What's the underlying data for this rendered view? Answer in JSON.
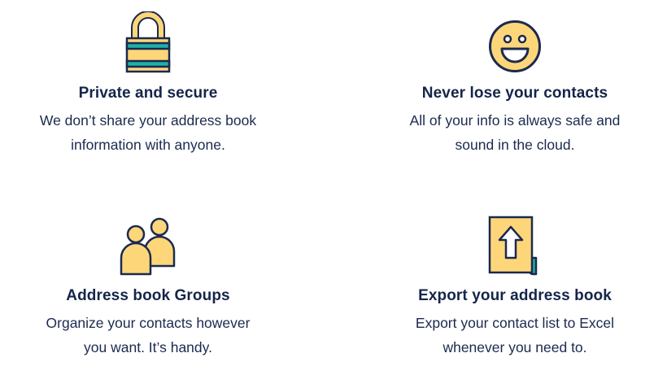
{
  "colors": {
    "navy": "#1b2a4e",
    "yellow": "#fed67a",
    "teal": "#1fb0a8"
  },
  "features": [
    {
      "icon": "padlock-icon",
      "title": "Private and secure",
      "line1": "We don’t share your address book",
      "line2": "information with anyone."
    },
    {
      "icon": "smiley-face-icon",
      "title": "Never lose your contacts",
      "line1": "All of your info is always safe and",
      "line2": "sound in the cloud."
    },
    {
      "icon": "people-group-icon",
      "title": "Address book Groups",
      "line1": "Organize your contacts however",
      "line2": "you want. It’s handy."
    },
    {
      "icon": "export-document-icon",
      "title": "Export your address book",
      "line1": "Export your contact list to Excel",
      "line2": "whenever you need to."
    }
  ]
}
